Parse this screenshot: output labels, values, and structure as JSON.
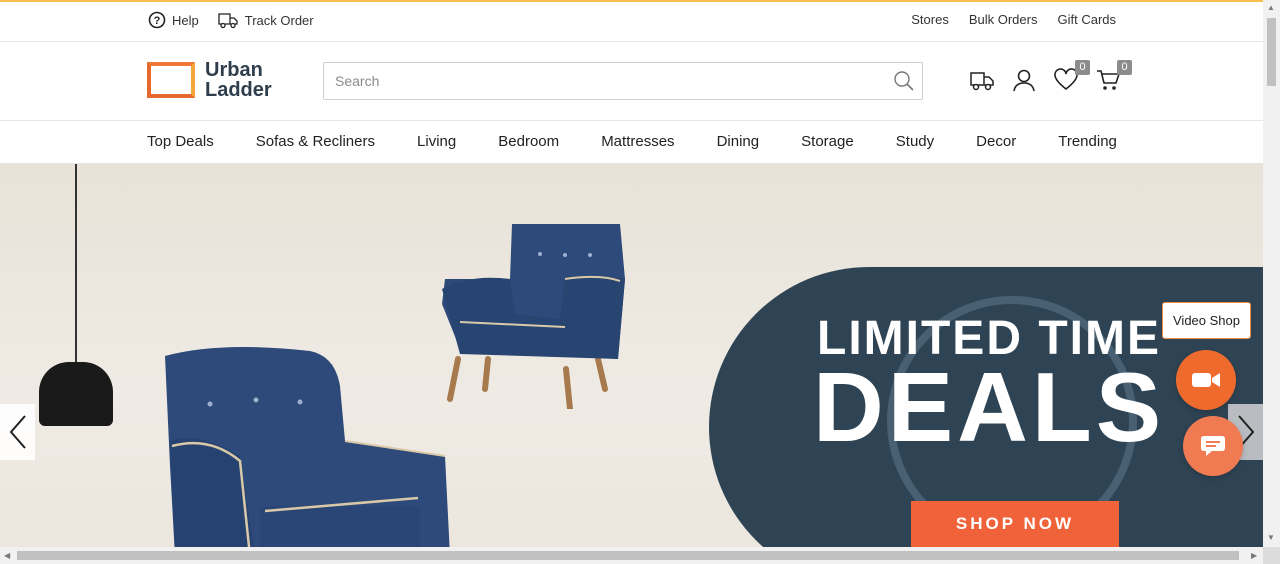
{
  "utility_bar": {
    "help": "Help",
    "track_order": "Track Order",
    "links": [
      "Stores",
      "Bulk Orders",
      "Gift Cards"
    ]
  },
  "header": {
    "logo_line1": "Urban",
    "logo_line2": "Ladder",
    "search_placeholder": "Search",
    "wishlist_count": "0",
    "cart_count": "0"
  },
  "nav": {
    "items": [
      "Top Deals",
      "Sofas & Recliners",
      "Living",
      "Bedroom",
      "Mattresses",
      "Dining",
      "Storage",
      "Study",
      "Decor",
      "Trending"
    ]
  },
  "hero": {
    "line1": "LIMITED TIME",
    "line2": "DEALS",
    "cta": "SHOP NOW"
  },
  "floating": {
    "video_tip": "Video Shop"
  },
  "colors": {
    "brand_orange": "#ef6b2d",
    "panel_navy": "#2e4454",
    "chair_blue": "#2d4a7a"
  }
}
